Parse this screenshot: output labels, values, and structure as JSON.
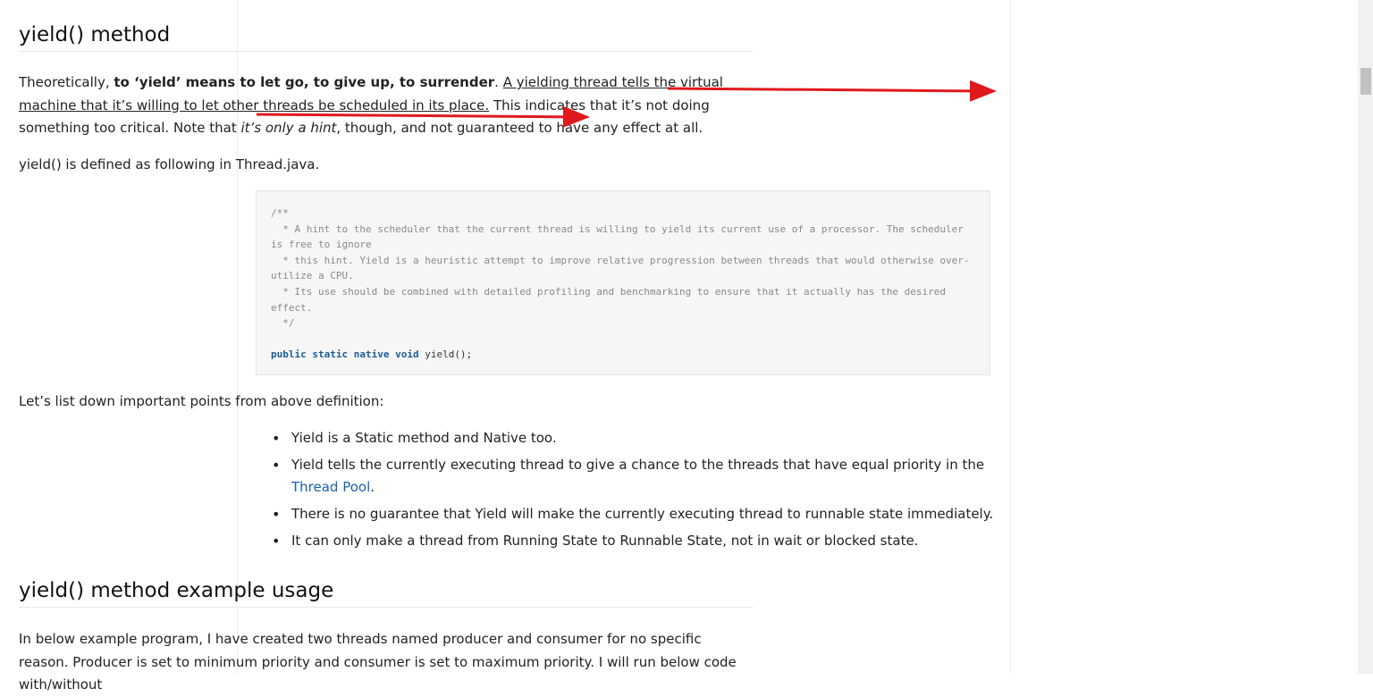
{
  "section1": {
    "heading": "yield() method",
    "intro_prefix": "Theoretically, ",
    "intro_bold": "to ‘yield’ means to let go, to give up, to surrender",
    "intro_dot": ". ",
    "intro_underlined": "A yielding thread tells the virtual machine that it’s willing to let other threads be scheduled in its place.",
    "intro_rest": " This indicates that it’s not doing something too critical. Note that ",
    "intro_italic": "it’s only a hint",
    "intro_end": ", though, and not guaranteed to have any effect at all.",
    "defined_as": "yield() is defined as following in Thread.java.",
    "code_comment": "/**\n  * A hint to the scheduler that the current thread is willing to yield its current use of a processor. The scheduler is free to ignore\n  * this hint. Yield is a heuristic attempt to improve relative progression between threads that would otherwise over-utilize a CPU.\n  * Its use should be combined with detailed profiling and benchmarking to ensure that it actually has the desired effect.\n  */",
    "code_keywords": "public static native void",
    "code_fn": " yield();",
    "list_intro": "Let’s list down important points from above definition:",
    "bullets": [
      "Yield is a Static method and Native too.",
      "Yield tells the currently executing thread to give a chance to the threads that have equal priority in the ",
      "There is no guarantee that Yield will make the currently executing thread to runnable state immediately.",
      "It can only make a thread from Running State to Runnable State, not in wait or blocked state."
    ],
    "bullet2_link": "Thread Pool",
    "bullet2_end": "."
  },
  "section2": {
    "heading": "yield() method example usage",
    "paragraph": "In below example program, I have created two threads named producer and consumer for no specific reason. Producer is set to minimum priority and consumer is set to maximum priority. I will run below code with/without"
  },
  "colors": {
    "annotation_arrow": "#e0191c",
    "link": "#1a63b0",
    "keyword": "#1c5c96"
  }
}
